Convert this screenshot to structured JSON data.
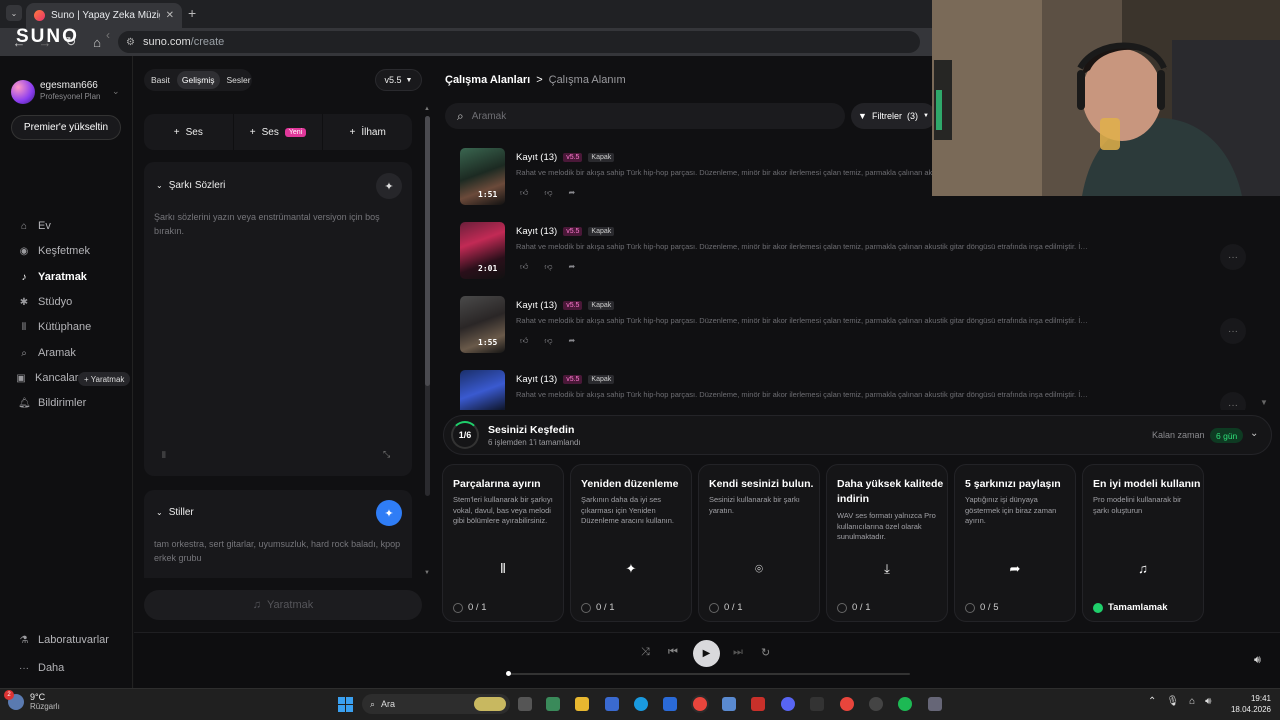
{
  "browser": {
    "tab_title": "Suno | Yapay Zeka Müziği",
    "url_domain": "suno.com",
    "url_path": "/create"
  },
  "sidebar": {
    "logo": "SUNO",
    "user": {
      "name": "egesman666",
      "plan": "Profesyonel Plan"
    },
    "premium_label": "Premier'e yükseltin",
    "items": [
      {
        "label": "Ev",
        "icon": "home-icon"
      },
      {
        "label": "Keşfetmek",
        "icon": "compass-icon"
      },
      {
        "label": "Yaratmak",
        "icon": "music-note-icon",
        "active": true
      },
      {
        "label": "Stüdyo",
        "icon": "studio-icon"
      },
      {
        "label": "Kütüphane",
        "icon": "library-icon"
      },
      {
        "label": "Aramak",
        "icon": "search-icon"
      },
      {
        "label": "Kancalar",
        "icon": "hooks-icon"
      },
      {
        "label": "Bildirimler",
        "icon": "bell-icon"
      }
    ],
    "hooks_create": "+ Yaratmak",
    "bottom": [
      {
        "label": "Laboratuvarlar",
        "icon": "flask-icon"
      },
      {
        "label": "Daha",
        "icon": "more-icon"
      }
    ]
  },
  "create": {
    "modes": [
      "Basit",
      "Gelişmiş",
      "Sesler"
    ],
    "active_mode": "Gelişmiş",
    "version": "v5.5",
    "add": [
      {
        "label": "Ses"
      },
      {
        "label": "Ses",
        "badge": "Yeni"
      },
      {
        "label": "İlham"
      }
    ],
    "lyrics": {
      "title": "Şarkı Sözleri",
      "placeholder": "Şarkı sözlerini yazın veya enstrümantal versiyon için boş bırakın."
    },
    "styles": {
      "title": "Stiller",
      "placeholder": "tam orkestra, sert gitarlar, uyumsuzluk, hard rock baladı, kpop erkek grubu"
    },
    "create_button": "Yaratmak"
  },
  "workspace": {
    "crumb_root": "Çalışma Alanları",
    "crumb_sep": ">",
    "crumb_current": "Çalışma Alanım",
    "search_placeholder": "Aramak",
    "filters_label": "Filtreler",
    "filters_count": "(3)",
    "songs": [
      {
        "title": "Kayıt (13)",
        "version": "v5.5",
        "tag": "Kapak",
        "duration": "1:51",
        "desc": "Rahat ve melodik bir akışa sahip Türk hip-hop parçası. Düzenleme, minör bir akor ilerlemesi çalan temiz, parmakla çalınan akustik gitar döngüsü etrafında inşa edilmiştir. İsti..."
      },
      {
        "title": "Kayıt (13)",
        "version": "v5.5",
        "tag": "Kapak",
        "duration": "2:01",
        "desc": "Rahat ve melodik bir akışa sahip Türk hip-hop parçası. Düzenleme, minör bir akor ilerlemesi çalan temiz, parmakla çalınan akustik gitar döngüsü etrafında inşa edilmiştir. İsti..."
      },
      {
        "title": "Kayıt (13)",
        "version": "v5.5",
        "tag": "Kapak",
        "duration": "1:55",
        "desc": "Rahat ve melodik bir akışa sahip Türk hip-hop parçası. Düzenleme, minör bir akor ilerlemesi çalan temiz, parmakla çalınan akustik gitar döngüsü etrafında inşa edilmiştir. İsti..."
      },
      {
        "title": "Kayıt (13)",
        "version": "v5.5",
        "tag": "Kapak",
        "duration": "",
        "desc": "Rahat ve melodik bir akışa sahip Türk hip-hop parçası. Düzenleme, minör bir akor ilerlemesi çalan temiz, parmakla çalınan akustik gitar döngüsü etrafında inşa edilmiştir. İsti..."
      }
    ]
  },
  "discover": {
    "progress": "1/6",
    "title": "Sesinizi Keşfedin",
    "subtitle": "6 işlemden 1'i tamamlandı",
    "time_label": "Kalan zaman",
    "time_value": "6 gün",
    "cards": [
      {
        "title": "Parçalarına ayırın",
        "desc": "Stem'leri kullanarak bir şarkıyı vokal, davul, bas veya melodi gibi bölümlere ayırabilirsiniz.",
        "icon": "waveform-icon",
        "progress": "0 / 1",
        "done": false
      },
      {
        "title": "Yeniden düzenleme",
        "desc": "Şarkının daha da iyi ses çıkarması için Yeniden Düzenleme aracını kullanın.",
        "icon": "wand-icon",
        "progress": "0 / 1",
        "done": false
      },
      {
        "title": "Kendi sesinizi bulun.",
        "desc": "Sesinizi kullanarak bir şarkı yaratın.",
        "icon": "voice-scan-icon",
        "progress": "0 / 1",
        "done": false
      },
      {
        "title": "Daha yüksek kalitede indirin",
        "desc": "WAV ses formatı yalnızca Pro kullanıcılarına özel olarak sunulmaktadır.",
        "icon": "download-icon",
        "progress": "0 / 1",
        "done": false
      },
      {
        "title": "5 şarkınızı paylaşın",
        "desc": "Yaptığınız işi dünyaya göstermek için biraz zaman ayırın.",
        "icon": "share-icon",
        "progress": "0 / 5",
        "done": false
      },
      {
        "title": "En iyi modeli kullanın",
        "desc": "Pro modelini kullanarak bir şarkı oluşturun",
        "icon": "music-note-icon",
        "progress": "Tamamlamak",
        "done": true
      }
    ]
  },
  "player": {
    "progress": 0.01
  },
  "taskbar": {
    "temp": "9°C",
    "condition": "Rüzgarlı",
    "search_label": "Ara",
    "time": "19:41",
    "date": "18.04.2026",
    "weather_badge": "2"
  }
}
